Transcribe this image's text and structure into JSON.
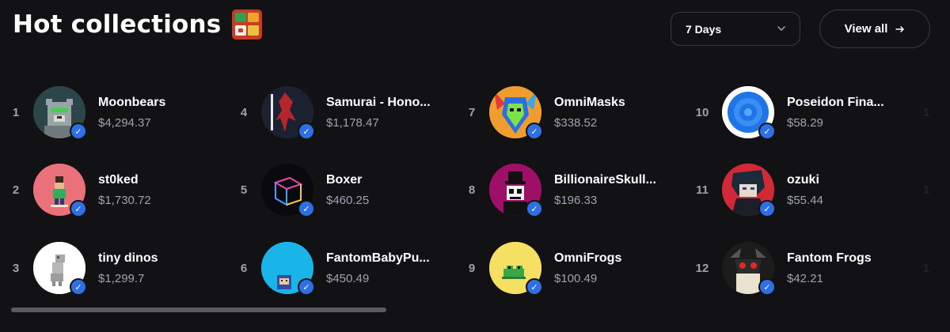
{
  "header": {
    "title": "Hot collections",
    "title_emoji": "bento-box-icon",
    "period_select": {
      "value": "7 Days",
      "icon": "chevron-down-icon"
    },
    "view_all": {
      "label": "View all",
      "icon": "arrow-right-icon"
    }
  },
  "verified_badge_icon": "checkmark-badge-icon",
  "collections": [
    {
      "rank": "1",
      "name": "Moonbears",
      "price": "$4,294.37"
    },
    {
      "rank": "2",
      "name": "st0ked",
      "price": "$1,730.72"
    },
    {
      "rank": "3",
      "name": "tiny dinos",
      "price": "$1,299.7"
    },
    {
      "rank": "4",
      "name": "Samurai - Hono...",
      "price": "$1,178.47"
    },
    {
      "rank": "5",
      "name": "Boxer",
      "price": "$460.25"
    },
    {
      "rank": "6",
      "name": "FantomBabyPu...",
      "price": "$450.49"
    },
    {
      "rank": "7",
      "name": "OmniMasks",
      "price": "$338.52"
    },
    {
      "rank": "8",
      "name": "BillionaireSkull...",
      "price": "$196.33"
    },
    {
      "rank": "9",
      "name": "OmniFrogs",
      "price": "$100.49"
    },
    {
      "rank": "10",
      "name": "Poseidon Fina...",
      "price": "$58.29"
    },
    {
      "rank": "11",
      "name": "ozuki",
      "price": "$55.44"
    },
    {
      "rank": "12",
      "name": "Fantom Frogs",
      "price": "$42.21"
    }
  ],
  "overflow_ranks": [
    "1",
    "1",
    "1"
  ],
  "colors": {
    "background": "#121215",
    "muted_text": "#9ca3af",
    "verified_blue": "#2f6fe4",
    "border": "#3a3a42"
  }
}
